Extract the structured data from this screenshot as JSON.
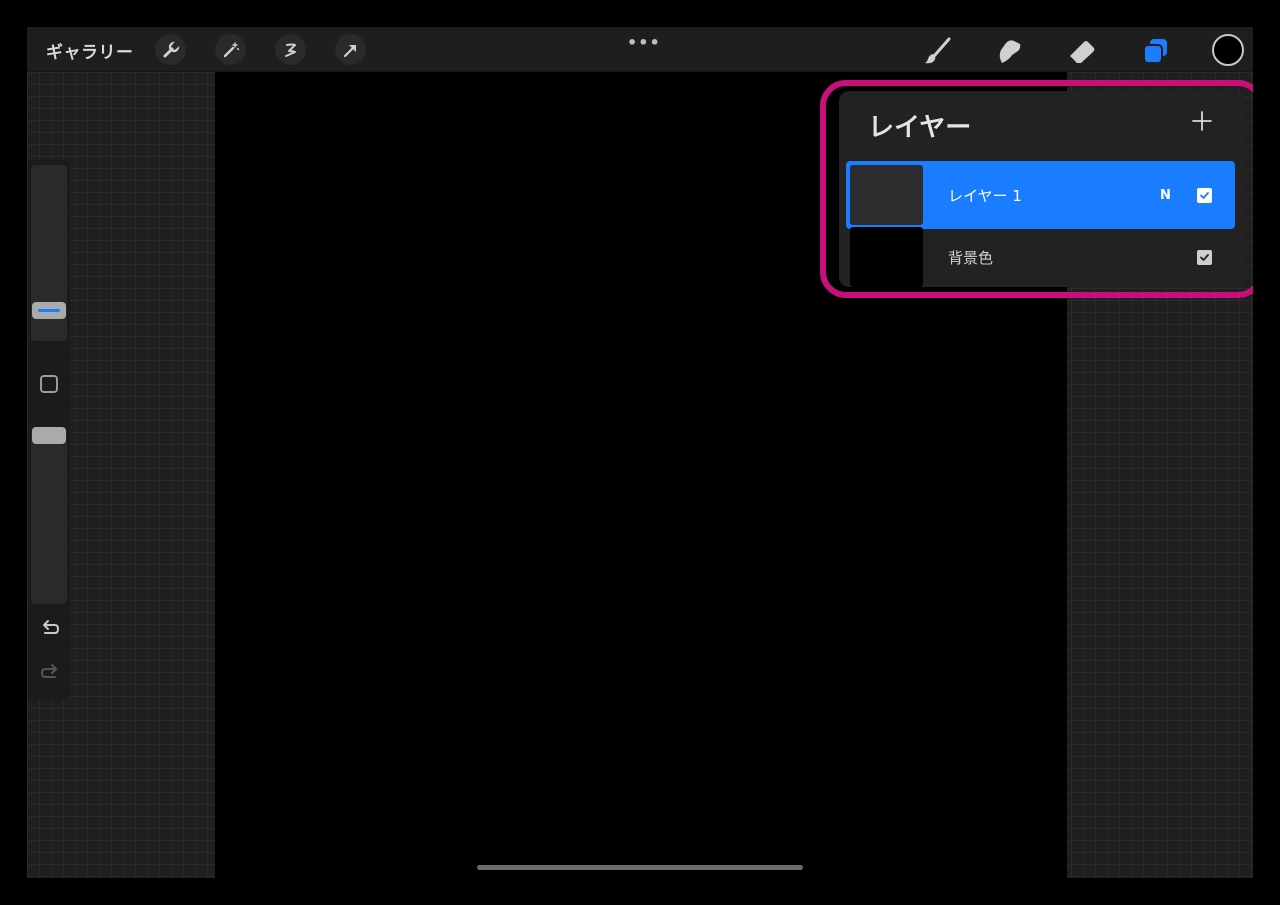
{
  "toolbar": {
    "gallery_label": "ギャラリー",
    "more_label": "•••",
    "left_tools": [
      "wrench-icon",
      "magic-wand-icon",
      "selection-icon",
      "transform-arrow-icon"
    ],
    "right_tools": [
      "brush-icon",
      "smudge-icon",
      "eraser-icon",
      "layers-icon"
    ],
    "active_tool": "layers-icon",
    "current_color": "#000000"
  },
  "sidebar": {
    "brush_size_level": 0.82,
    "opacity_level": 0.63,
    "modify_icon": "square-icon",
    "undo_icon": "undo-icon",
    "redo_icon": "redo-icon"
  },
  "layers_panel": {
    "title": "レイヤー",
    "add_icon": "plus-icon",
    "layers": [
      {
        "name": "レイヤー 1",
        "blend_mode": "N",
        "visible": true,
        "selected": true,
        "thumb_color": "#2c2c2e"
      },
      {
        "name": "背景色",
        "blend_mode": "",
        "visible": true,
        "selected": false,
        "thumb_color": "#000000"
      }
    ]
  },
  "colors": {
    "accent": "#1a7cff",
    "highlight": "#c8107a",
    "panel": "#222222",
    "canvas": "#000000"
  }
}
